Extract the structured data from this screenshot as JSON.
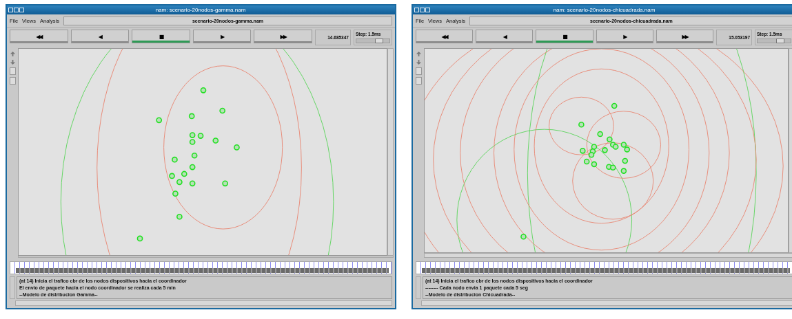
{
  "windows": [
    {
      "title": "nam: scenario-20nodos-gamma.nam",
      "menu": [
        "File",
        "Views",
        "Analysis"
      ],
      "file_name": "scenario-20nodos-gamma.nam",
      "controls": [
        {
          "symbol": "◀◀",
          "selected": false
        },
        {
          "symbol": "◀",
          "selected": false
        },
        {
          "symbol": "■",
          "selected": true
        },
        {
          "symbol": "▶",
          "selected": false
        },
        {
          "symbol": "▶▶",
          "selected": false
        }
      ],
      "time": "14.685347",
      "step": "Step: 1.5ms",
      "step_slider": {
        "level": 0.7
      },
      "annotations": [
        "(at 14) Inicia el trafico cbr de los nodos dispositivos hacia el coordinador",
        "El envio de paquete hacia el nodo coordinador se realiza cada 5 min",
        "--Modelo de distribucion Gamma--"
      ]
    },
    {
      "title": "nam: scenario-20nodos-chicuadrada.nam",
      "menu": [
        "File",
        "Views",
        "Analysis"
      ],
      "file_name": "scenario-20nodos-chicuadrada.nam",
      "controls": [
        {
          "symbol": "◀◀",
          "selected": false
        },
        {
          "symbol": "◀",
          "selected": false
        },
        {
          "symbol": "■",
          "selected": true
        },
        {
          "symbol": "▶",
          "selected": false
        },
        {
          "symbol": "▶▶",
          "selected": false
        }
      ],
      "time": "15.053197",
      "step": "Step: 1.5ms",
      "step_slider": {
        "level": 0.7
      },
      "annotations": [
        "(at 14) Inicia el trafico cbr de los nodos dispositivos hacia el coordinador",
        "-------- Cada nodo envia 1 paquete cada 5 seg",
        "--Modelo de distribucion Chicuadrada--"
      ]
    }
  ]
}
